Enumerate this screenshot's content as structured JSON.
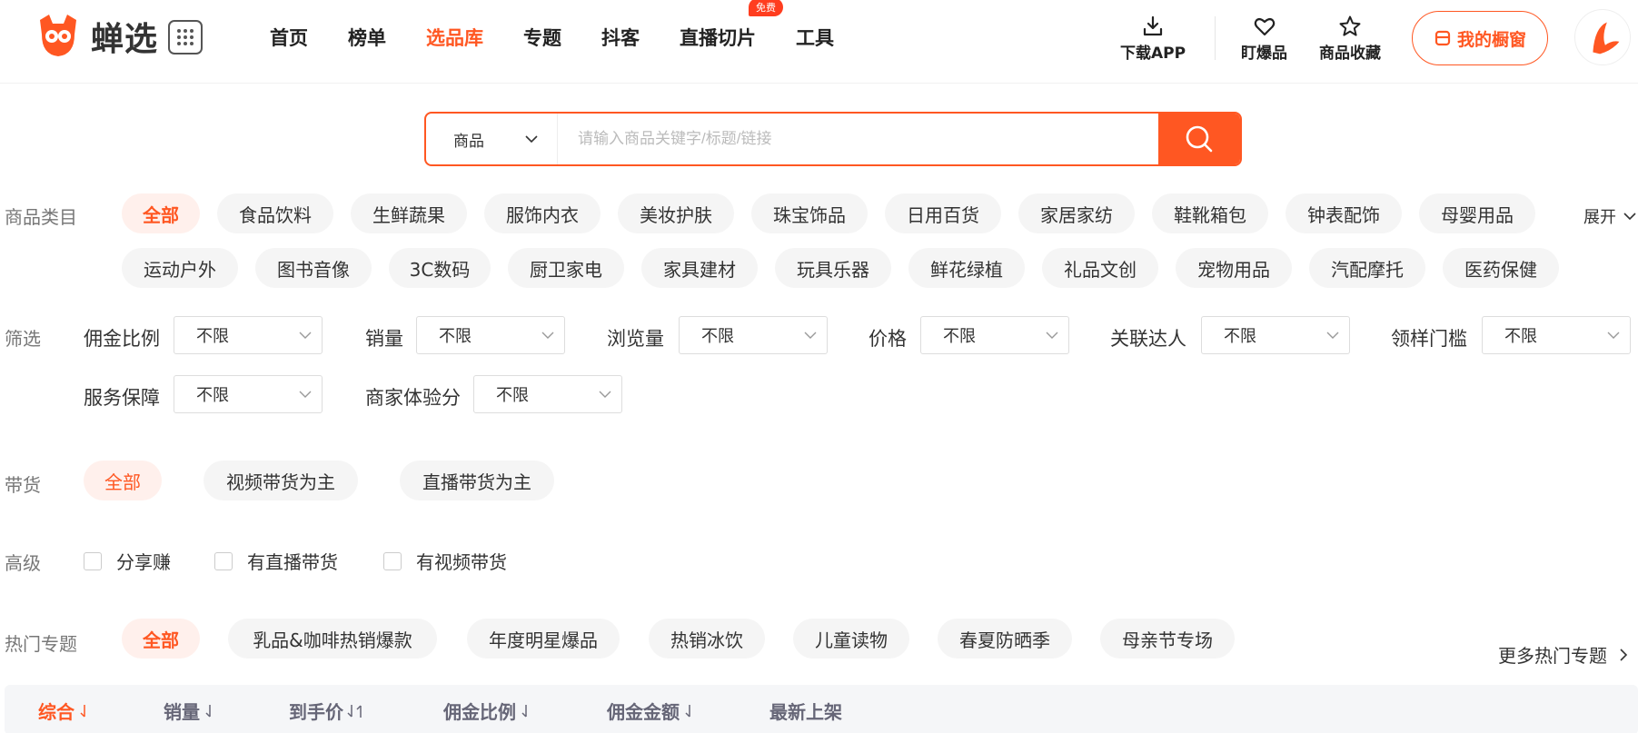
{
  "brand": {
    "name": "蝉选",
    "accent": "#ff5722"
  },
  "nav": {
    "items": [
      "首页",
      "榜单",
      "选品库",
      "专题",
      "抖客",
      "直播切片",
      "工具"
    ],
    "active_index": 2,
    "badge_text": "免费"
  },
  "header_tools": {
    "download": "下载APP",
    "hot": "盯爆品",
    "favorites": "商品收藏",
    "window": "我的橱窗"
  },
  "search": {
    "type_value": "商品",
    "placeholder": "请输入商品关键字/标题/链接",
    "icons": {
      "button": "search-icon",
      "dropdown": "chevron-down-icon"
    }
  },
  "categories": {
    "label": "商品类目",
    "expand": "展开",
    "row1": [
      "全部",
      "食品饮料",
      "生鲜蔬果",
      "服饰内衣",
      "美妆护肤",
      "珠宝饰品",
      "日用百货",
      "家居家纺",
      "鞋靴箱包",
      "钟表配饰",
      "母婴用品"
    ],
    "row2": [
      "运动户外",
      "图书音像",
      "3C数码",
      "厨卫家电",
      "家具建材",
      "玩具乐器",
      "鲜花绿植",
      "礼品文创",
      "宠物用品",
      "汽配摩托",
      "医药保健"
    ]
  },
  "filters": {
    "label": "筛选",
    "items": [
      {
        "label": "佣金比例",
        "value": "不限"
      },
      {
        "label": "销量",
        "value": "不限"
      },
      {
        "label": "浏览量",
        "value": "不限"
      },
      {
        "label": "价格",
        "value": "不限"
      },
      {
        "label": "关联达人",
        "value": "不限"
      },
      {
        "label": "领样门槛",
        "value": "不限"
      },
      {
        "label": "服务保障",
        "value": "不限"
      },
      {
        "label": "商家体验分",
        "value": "不限"
      }
    ]
  },
  "delivery": {
    "label": "带货",
    "options": [
      "全部",
      "视频带货为主",
      "直播带货为主"
    ]
  },
  "advanced": {
    "label": "高级",
    "options": [
      "分享赚",
      "有直播带货",
      "有视频带货"
    ]
  },
  "topics": {
    "label": "热门专题",
    "options": [
      "全部",
      "乳品&咖啡热销爆款",
      "年度明星爆品",
      "热销冰饮",
      "儿童读物",
      "春夏防晒季",
      "母亲节专场"
    ],
    "more": "更多热门专题"
  },
  "sort": {
    "items": [
      "综合",
      "销量",
      "到手价",
      "佣金比例",
      "佣金金额",
      "最新上架"
    ],
    "active_index": 0
  }
}
